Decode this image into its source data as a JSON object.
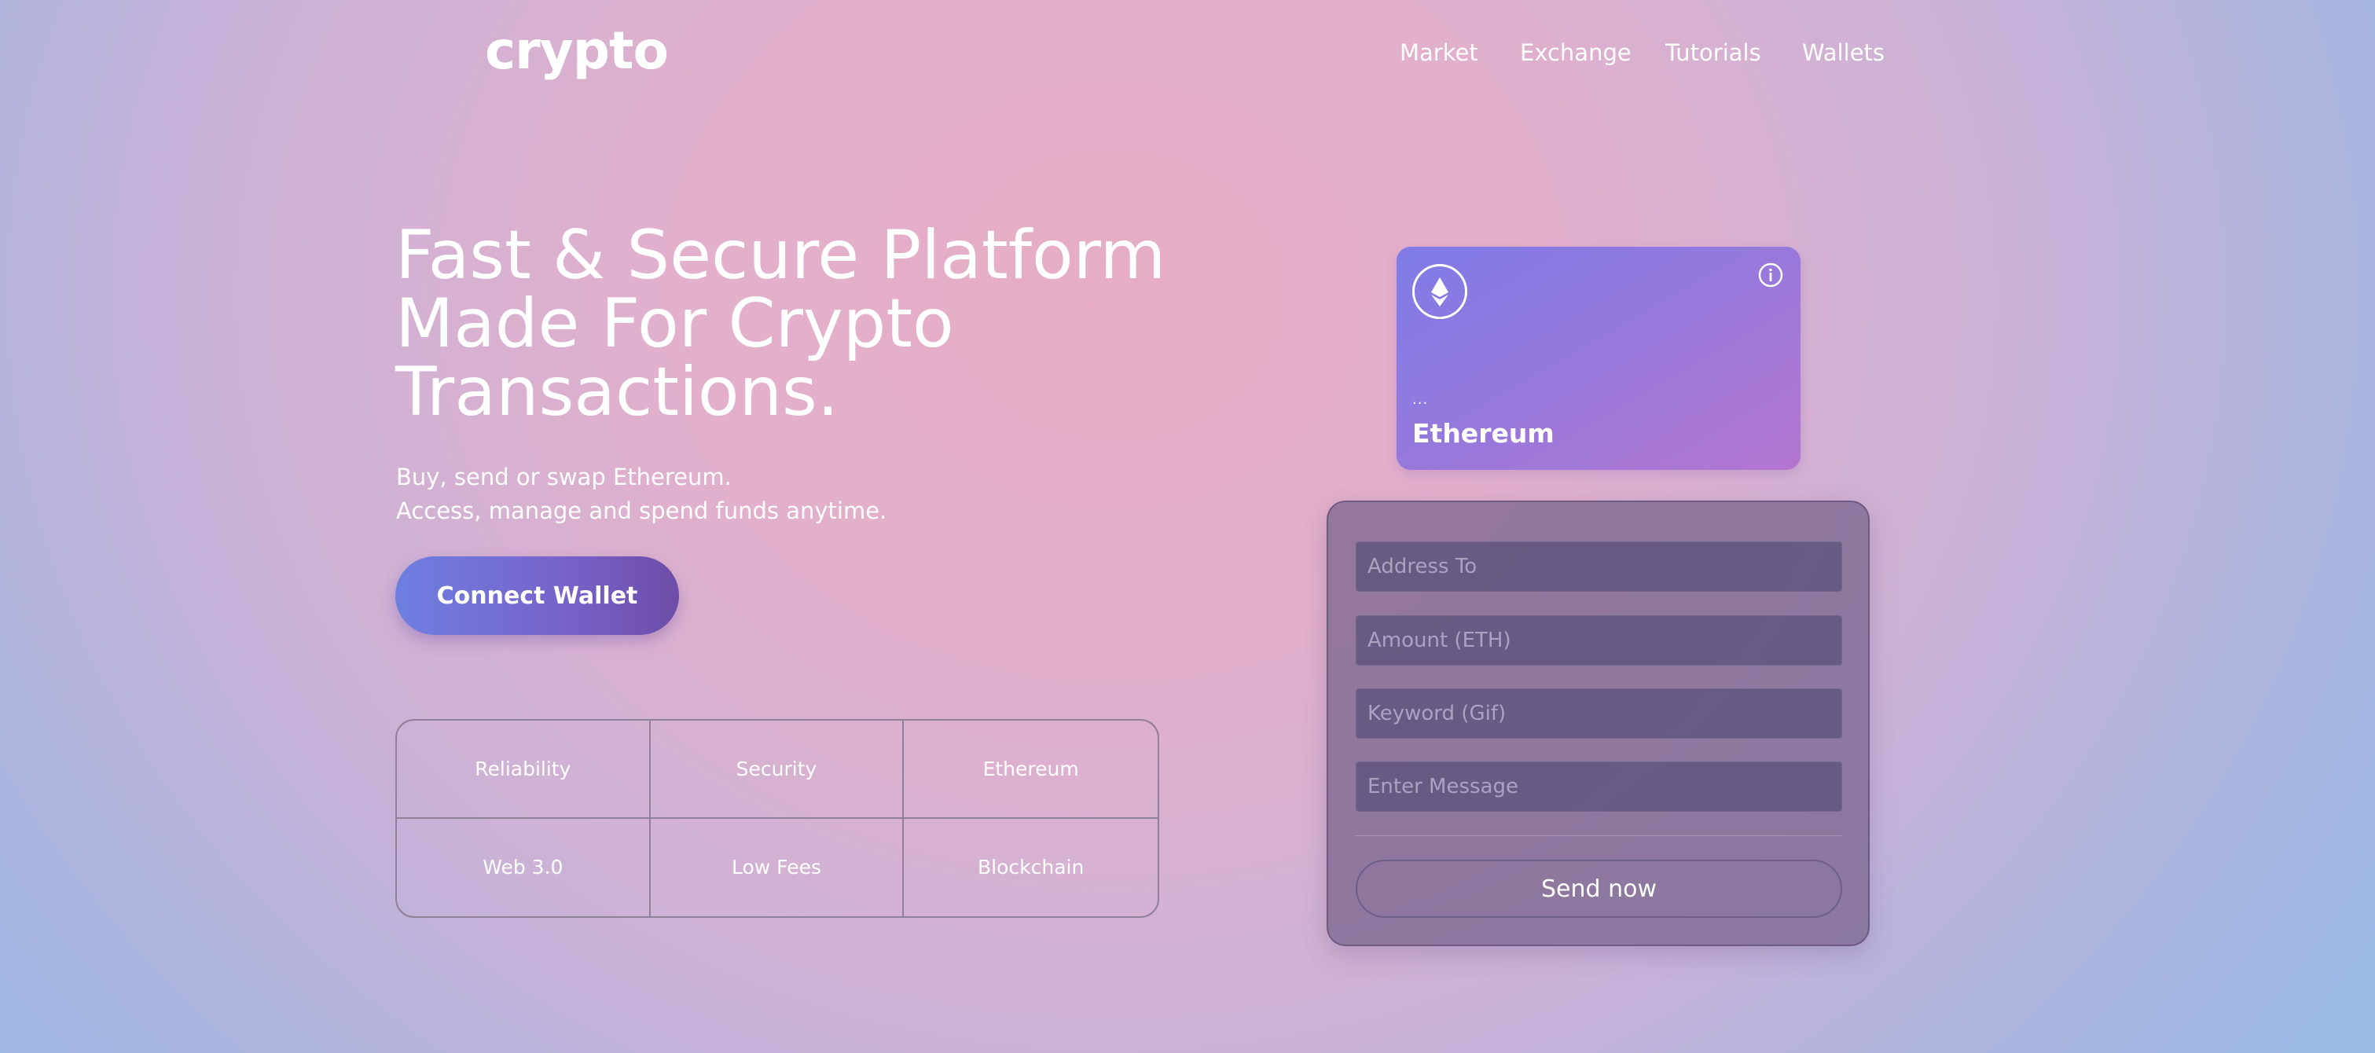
{
  "brand": {
    "logo_text": "crypto"
  },
  "nav": {
    "items": [
      "Market",
      "Exchange",
      "Tutorials",
      "Wallets"
    ]
  },
  "hero": {
    "title_lines": [
      "Fast & Secure Platform",
      "Made For Crypto",
      "Transactions."
    ],
    "subtitle_lines": [
      "Buy, send or swap Ethereum.",
      "Access, manage and spend funds anytime."
    ],
    "connect_label": "Connect Wallet"
  },
  "features": [
    "Reliability",
    "Security",
    "Ethereum",
    "Web 3.0",
    "Low Fees",
    "Blockchain"
  ],
  "card": {
    "address": "...",
    "network": "Ethereum",
    "icon": "ethereum-icon",
    "info_icon": "info-icon"
  },
  "form": {
    "address_placeholder": "Address To",
    "amount_placeholder": "Amount (ETH)",
    "keyword_placeholder": "Keyword (Gif)",
    "message_placeholder": "Enter Message",
    "send_label": "Send now"
  },
  "colors": {
    "background_center": "#e7adc5",
    "background_edge": "#9cb8e4",
    "button_gradient_start": "#6e7fe0",
    "button_gradient_end": "#6d4da8",
    "card_gradient_start": "#7f7be6",
    "card_gradient_end": "#b476cf",
    "panel": "#7a6890",
    "field": "#5f5a80"
  }
}
